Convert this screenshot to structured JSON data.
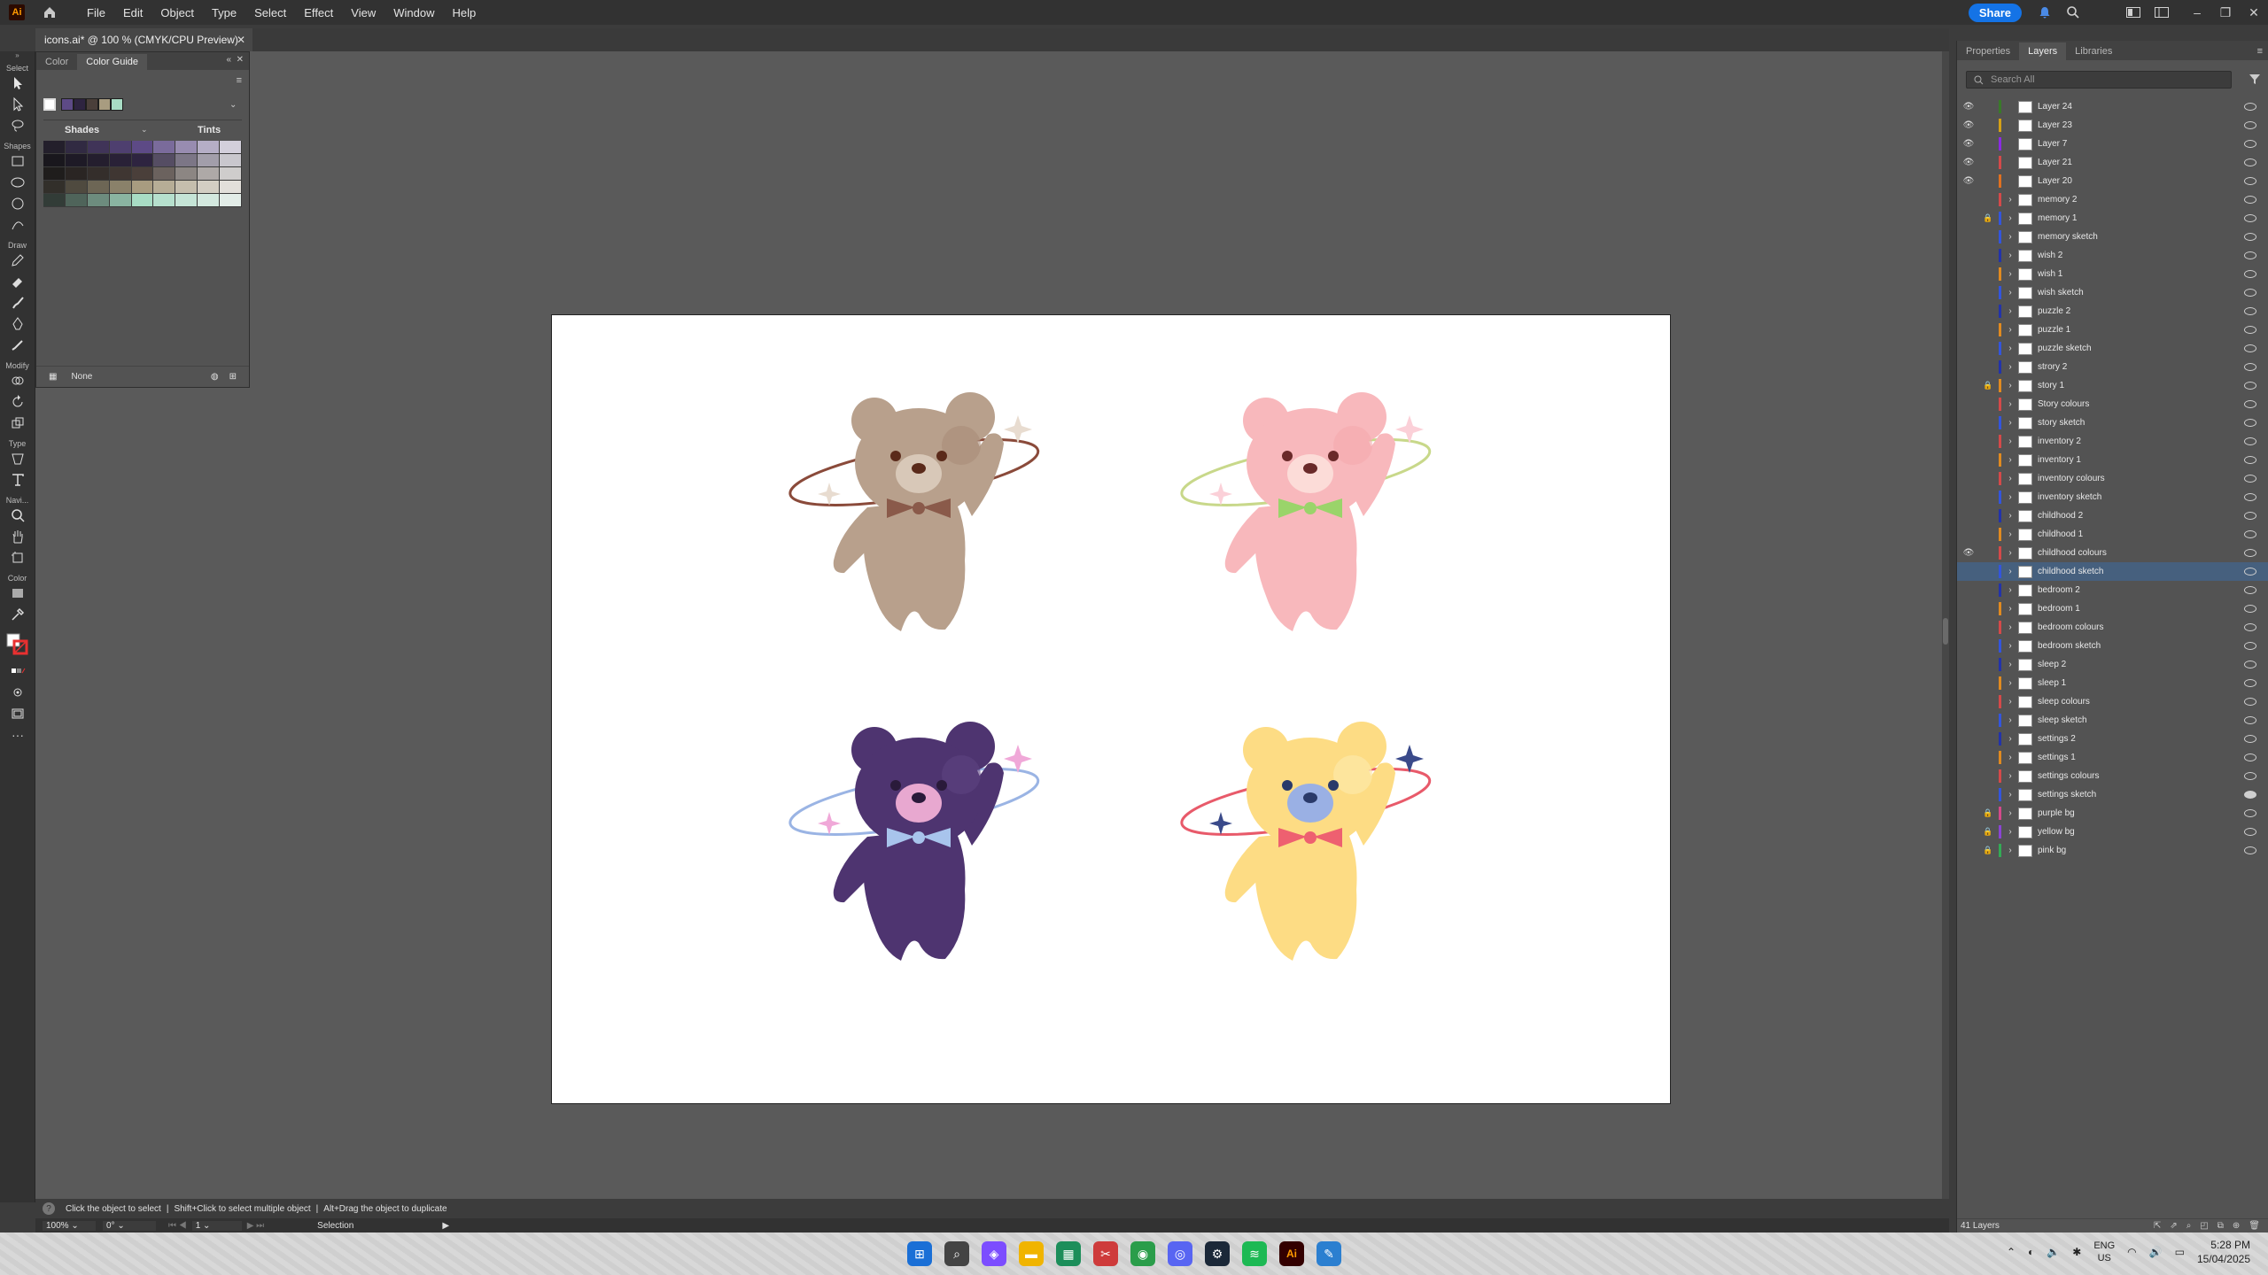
{
  "app": {
    "logo": "Ai"
  },
  "menu": [
    "File",
    "Edit",
    "Object",
    "Type",
    "Select",
    "Effect",
    "View",
    "Window",
    "Help"
  ],
  "share_label": "Share",
  "doc_tab": "icons.ai* @ 100 % (CMYK/CPU Preview)",
  "toolbar": {
    "groups": [
      "Select",
      "Shapes",
      "Draw",
      "Modify",
      "Type",
      "Navi...",
      "Color"
    ]
  },
  "color_panel": {
    "tabs": [
      "Color",
      "Color Guide"
    ],
    "active_tab": "Color Guide",
    "shades_label": "Shades",
    "tints_label": "Tints",
    "footer_label": "None",
    "harmony_colors": [
      "#ffffff",
      "#5d4a86",
      "#2e2440",
      "#4a3f3a",
      "#a89c80",
      "#a8dcc4"
    ]
  },
  "right_panel": {
    "tabs": [
      "Properties",
      "Layers",
      "Libraries"
    ],
    "active_tab": "Layers",
    "search_placeholder": "Search All",
    "layers": [
      {
        "name": "Layer 24",
        "eye": true,
        "lock": false,
        "color": "#3a7a2a",
        "chev": false
      },
      {
        "name": "Layer 23",
        "eye": true,
        "lock": false,
        "color": "#d4a017",
        "chev": false
      },
      {
        "name": "Layer 7",
        "eye": true,
        "lock": false,
        "color": "#8a2be2",
        "chev": false
      },
      {
        "name": "Layer 21",
        "eye": true,
        "lock": false,
        "color": "#d44a4a",
        "chev": false
      },
      {
        "name": "Layer 20",
        "eye": true,
        "lock": false,
        "color": "#e07020",
        "chev": false
      },
      {
        "name": "memory 2",
        "eye": false,
        "lock": false,
        "color": "#d44a4a",
        "chev": true
      },
      {
        "name": "memory 1",
        "eye": false,
        "lock": true,
        "color": "#3355dd",
        "chev": true
      },
      {
        "name": "memory sketch",
        "eye": false,
        "lock": false,
        "color": "#3355dd",
        "chev": true
      },
      {
        "name": "wish 2",
        "eye": false,
        "lock": false,
        "color": "#2233aa",
        "chev": true
      },
      {
        "name": "wish 1",
        "eye": false,
        "lock": false,
        "color": "#e08a20",
        "chev": true
      },
      {
        "name": "wish sketch",
        "eye": false,
        "lock": false,
        "color": "#3355dd",
        "chev": true
      },
      {
        "name": "puzzle 2",
        "eye": false,
        "lock": false,
        "color": "#2233aa",
        "chev": true
      },
      {
        "name": "puzzle 1",
        "eye": false,
        "lock": false,
        "color": "#e08a20",
        "chev": true
      },
      {
        "name": "puzzle sketch",
        "eye": false,
        "lock": false,
        "color": "#3355dd",
        "chev": true
      },
      {
        "name": "strory 2",
        "eye": false,
        "lock": false,
        "color": "#2233aa",
        "chev": true
      },
      {
        "name": "story 1",
        "eye": false,
        "lock": true,
        "color": "#e08a20",
        "chev": true
      },
      {
        "name": "Story colours",
        "eye": false,
        "lock": false,
        "color": "#d44a4a",
        "chev": true
      },
      {
        "name": "story sketch",
        "eye": false,
        "lock": false,
        "color": "#3355dd",
        "chev": true
      },
      {
        "name": "inventory 2",
        "eye": false,
        "lock": false,
        "color": "#d44a4a",
        "chev": true
      },
      {
        "name": "inventory 1",
        "eye": false,
        "lock": false,
        "color": "#e08a20",
        "chev": true
      },
      {
        "name": "inventory colours",
        "eye": false,
        "lock": false,
        "color": "#d44a4a",
        "chev": true
      },
      {
        "name": "inventory sketch",
        "eye": false,
        "lock": false,
        "color": "#3355dd",
        "chev": true
      },
      {
        "name": "childhood 2",
        "eye": false,
        "lock": false,
        "color": "#2233aa",
        "chev": true
      },
      {
        "name": "childhood 1",
        "eye": false,
        "lock": false,
        "color": "#e08a20",
        "chev": true
      },
      {
        "name": "childhood colours",
        "eye": true,
        "lock": false,
        "color": "#d44a4a",
        "chev": true
      },
      {
        "name": "childhood sketch",
        "eye": false,
        "lock": false,
        "color": "#3355dd",
        "chev": true,
        "selected": true
      },
      {
        "name": "bedroom 2",
        "eye": false,
        "lock": false,
        "color": "#2233aa",
        "chev": true
      },
      {
        "name": "bedroom 1",
        "eye": false,
        "lock": false,
        "color": "#e08a20",
        "chev": true
      },
      {
        "name": "bedroom colours",
        "eye": false,
        "lock": false,
        "color": "#d44a4a",
        "chev": true
      },
      {
        "name": "bedroom sketch",
        "eye": false,
        "lock": false,
        "color": "#3355dd",
        "chev": true
      },
      {
        "name": "sleep 2",
        "eye": false,
        "lock": false,
        "color": "#2233aa",
        "chev": true
      },
      {
        "name": "sleep 1",
        "eye": false,
        "lock": false,
        "color": "#e08a20",
        "chev": true
      },
      {
        "name": "sleep colours",
        "eye": false,
        "lock": false,
        "color": "#d44a4a",
        "chev": true
      },
      {
        "name": "sleep sketch",
        "eye": false,
        "lock": false,
        "color": "#3355dd",
        "chev": true
      },
      {
        "name": "settings 2",
        "eye": false,
        "lock": false,
        "color": "#2233aa",
        "chev": true
      },
      {
        "name": "settings 1",
        "eye": false,
        "lock": false,
        "color": "#e08a20",
        "chev": true
      },
      {
        "name": "settings colours",
        "eye": false,
        "lock": false,
        "color": "#d44a4a",
        "chev": true
      },
      {
        "name": "settings sketch",
        "eye": false,
        "lock": false,
        "color": "#3355dd",
        "chev": true,
        "filled": true
      },
      {
        "name": "purple bg",
        "eye": false,
        "lock": true,
        "color": "#d44a8a",
        "chev": true
      },
      {
        "name": "yellow bg",
        "eye": false,
        "lock": true,
        "color": "#8a44d4",
        "chev": true
      },
      {
        "name": "pink bg",
        "eye": false,
        "lock": true,
        "color": "#33aa55",
        "chev": true
      }
    ],
    "layer_count": "41 Layers"
  },
  "status": {
    "hint1": "Click the object to select",
    "hint2": "Shift+Click to select multiple object",
    "hint3": "Alt+Drag the object to duplicate",
    "zoom": "100%",
    "rotation": "0°",
    "artboard": "1",
    "tool": "Selection"
  },
  "taskbar": {
    "lang1": "ENG",
    "lang2": "US",
    "time": "5:28 PM",
    "date": "15/04/2025"
  }
}
